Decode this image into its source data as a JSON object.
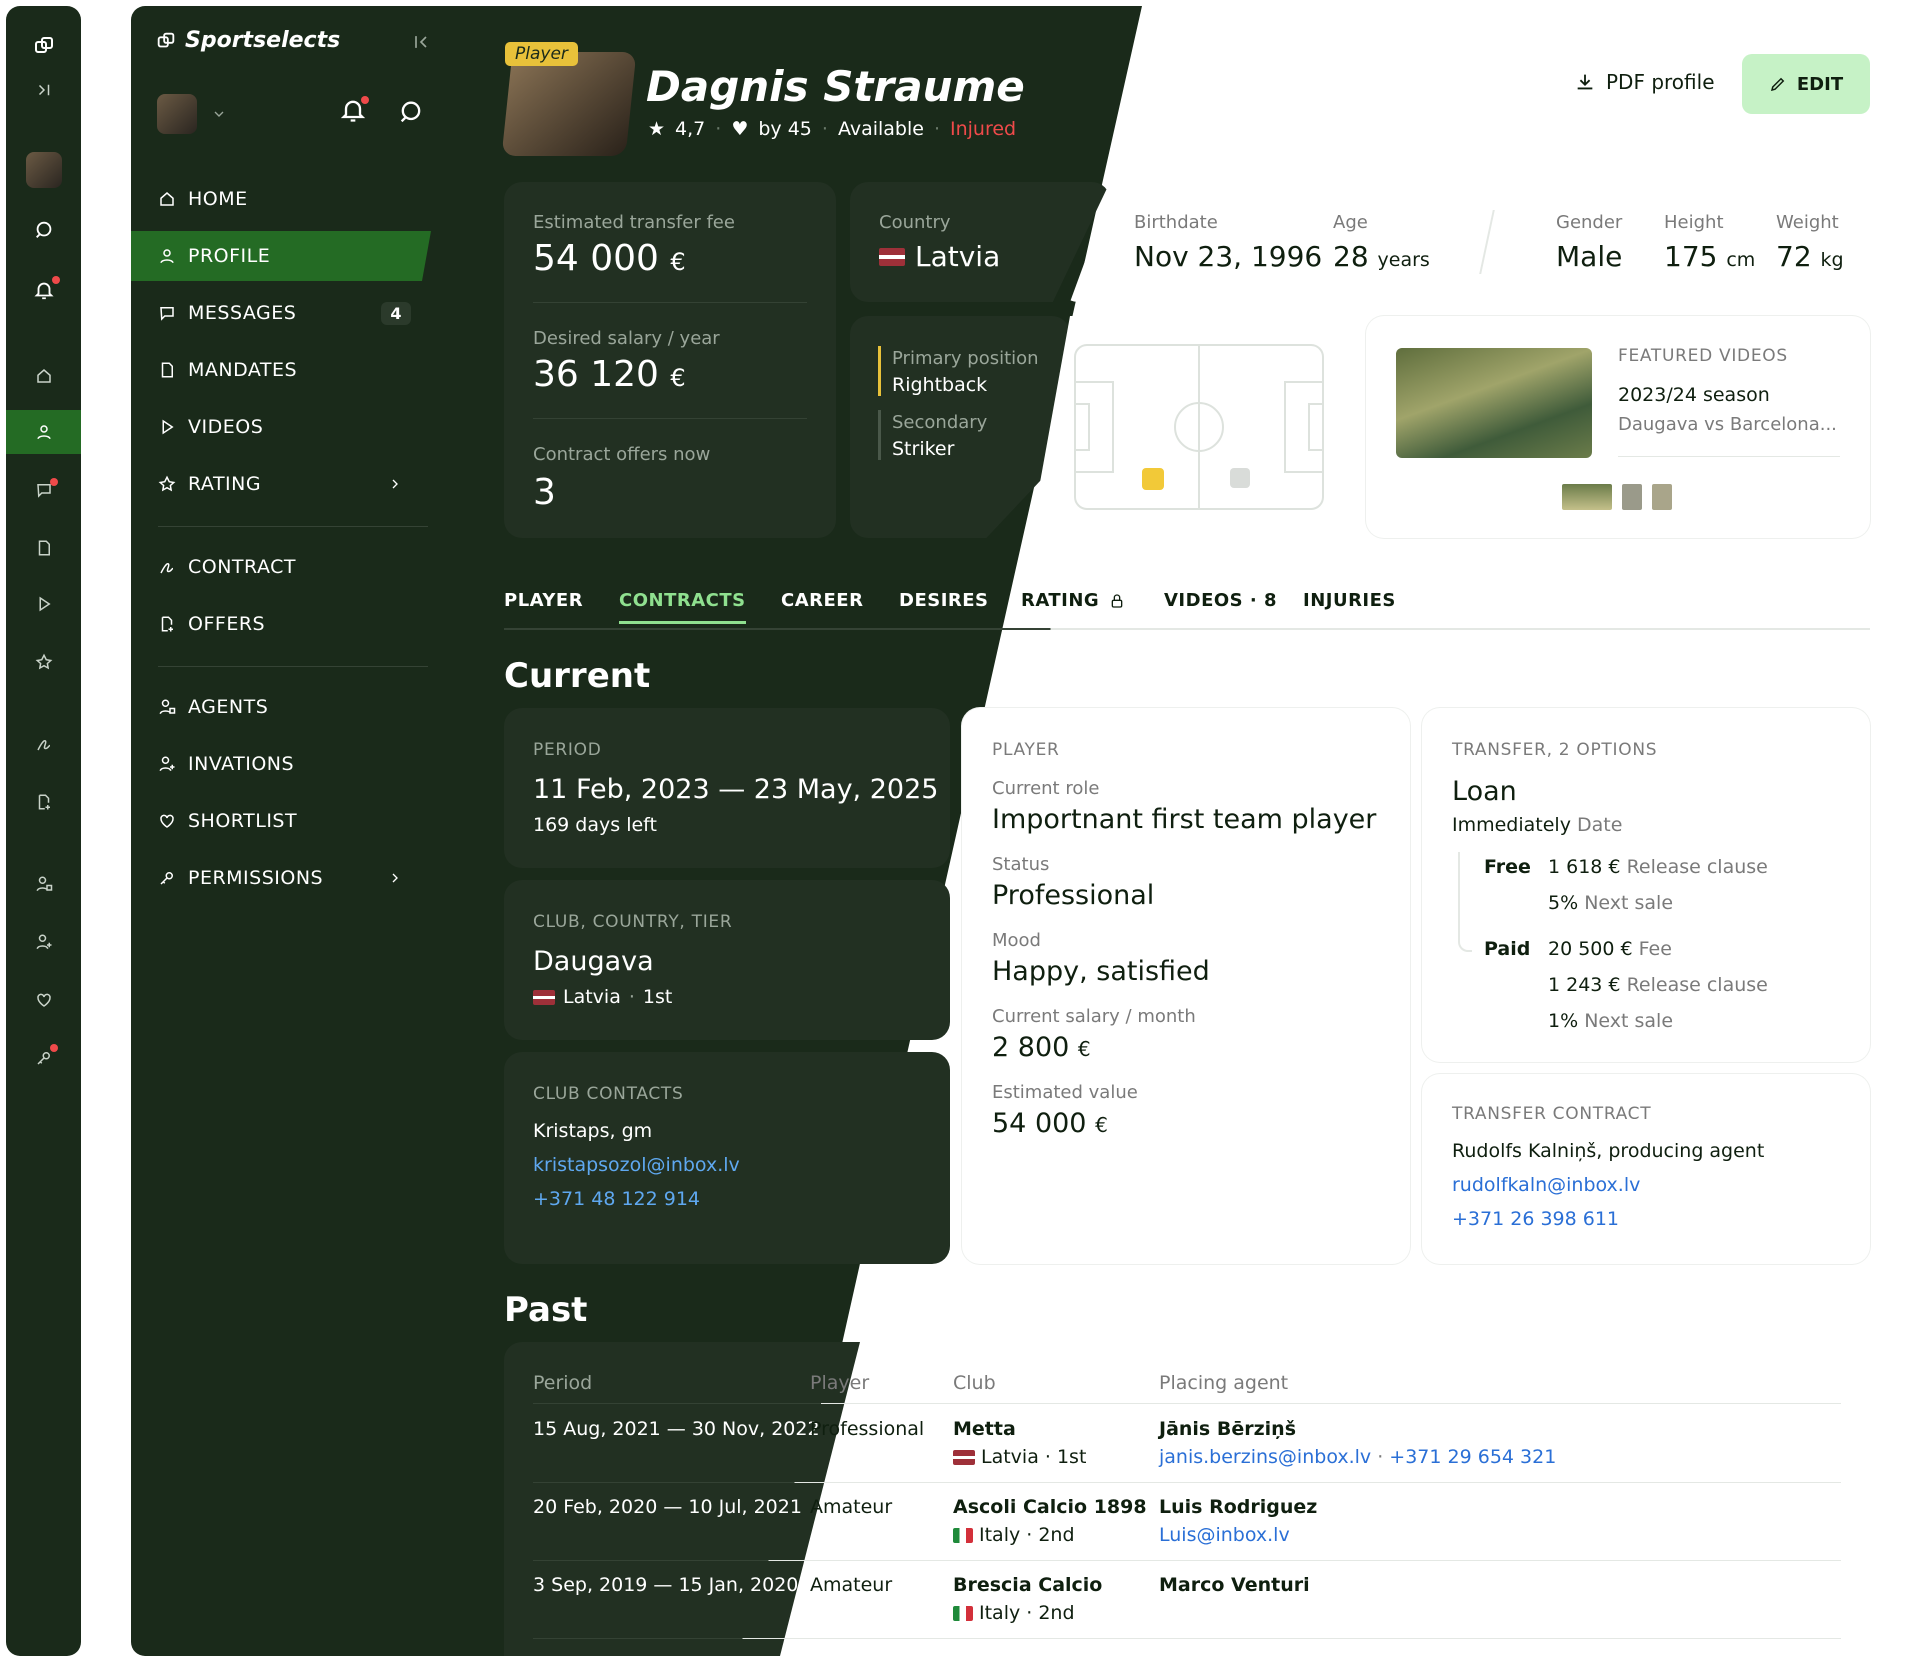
{
  "rail": {
    "icons": [
      "logo",
      "expand",
      "avatar",
      "search",
      "bell",
      "home",
      "profile",
      "messages",
      "mandates",
      "videos",
      "rating",
      "contract",
      "offers",
      "agents",
      "invations",
      "shortlist",
      "permissions"
    ]
  },
  "sidebar": {
    "brand": "Sportselects",
    "items": [
      {
        "label": "HOME"
      },
      {
        "label": "PROFILE"
      },
      {
        "label": "MESSAGES",
        "badge": "4"
      },
      {
        "label": "MANDATES"
      },
      {
        "label": "VIDEOS"
      },
      {
        "label": "RATING"
      },
      {
        "label": "CONTRACT"
      },
      {
        "label": "OFFERS"
      },
      {
        "label": "AGENTS"
      },
      {
        "label": "INVATIONS"
      },
      {
        "label": "SHORTLIST"
      },
      {
        "label": "PERMISSIONS"
      }
    ]
  },
  "header": {
    "tag": "Player",
    "name": "Dagnis Straume",
    "rating": "4,7",
    "likes": "by 45",
    "available": "Available",
    "injured": "Injured",
    "pdf": "PDF profile",
    "edit": "EDIT"
  },
  "stats": {
    "fee_label": "Estimated transfer fee",
    "fee": "54 000",
    "fee_cur": "€",
    "salary_label": "Desired salary / year",
    "salary": "36 120",
    "salary_cur": "€",
    "offers_label": "Contract offers now",
    "offers": "3",
    "country_label": "Country",
    "country": "Latvia",
    "birth_label": "Birthdate",
    "birth": "Nov 23, 1996",
    "age_label": "Age",
    "age": "28",
    "age_unit": "years",
    "gender_label": "Gender",
    "gender": "Male",
    "height_label": "Height",
    "height": "175",
    "height_unit": "cm",
    "weight_label": "Weight",
    "weight": "72",
    "weight_unit": "kg",
    "primary_label": "Primary position",
    "primary": "Rightback",
    "secondary_label": "Secondary",
    "secondary": "Striker"
  },
  "videos": {
    "label": "FEATURED VIDEOS",
    "season": "2023/24 season",
    "match": "Daugava vs Barcelona..."
  },
  "tabs": [
    "PLAYER",
    "CONTRACTS",
    "CAREER",
    "DESIRES",
    "RATING",
    "VIDEOS · 8",
    "INJURIES"
  ],
  "current": {
    "title": "Current",
    "period_label": "PERIOD",
    "period": "11 Feb, 2023 — 23 May, 2025",
    "days_left": "169 days left",
    "club_label": "CLUB, COUNTRY, TIER",
    "club": "Daugava",
    "club_country": "Latvia",
    "club_tier": "1st",
    "contacts_label": "CLUB CONTACTS",
    "contact_name": "Kristaps, gm",
    "contact_email": "kristapsozol@inbox.lv",
    "contact_phone": "+371 48 122 914",
    "player_label": "PLAYER",
    "role_label": "Current role",
    "role": "Importnant first team player",
    "status_label": "Status",
    "status": "Professional",
    "mood_label": "Mood",
    "mood": "Happy, satisfied",
    "csal_label": "Current salary / month",
    "csal": "2 800",
    "csal_cur": "€",
    "est_label": "Estimated value",
    "est": "54 000",
    "est_cur": "€",
    "transfer_label": "TRANSFER, 2 OPTIONS",
    "loan": "Loan",
    "immediately": "Immediately",
    "date": "Date",
    "free": "Free",
    "free_release": "1 618 €",
    "release_clause": "Release clause",
    "free_next": "5%",
    "next_sale": "Next sale",
    "paid": "Paid",
    "paid_fee": "20 500 €",
    "fee_word": "Fee",
    "paid_release": "1 243 €",
    "paid_next": "1%",
    "tc_label": "TRANSFER CONTRACT",
    "tc_name": "Rudolfs Kalniņš, producing agent",
    "tc_email": "rudolfkaln@inbox.lv",
    "tc_phone": "+371 26 398 611"
  },
  "past": {
    "title": "Past",
    "headers": [
      "Period",
      "Player",
      "Club",
      "Placing agent"
    ],
    "rows": [
      {
        "period": "15 Aug, 2021 — 30 Nov, 2022",
        "player": "Professional",
        "club": "Metta",
        "country": "Latvia · 1st",
        "agent": "Jānis Bērziņš",
        "email": "janis.berzins@inbox.lv",
        "sep": " · ",
        "phone": "+371 29 654 321"
      },
      {
        "period": "20 Feb, 2020 — 10 Jul, 2021",
        "player": "Amateur",
        "club": "Ascoli Calcio 1898",
        "country": "Italy · 2nd",
        "agent": "Luis Rodriguez",
        "email": "Luis@inbox.lv",
        "sep": "",
        "phone": ""
      },
      {
        "period": "3 Sep, 2019 — 15 Jan, 2020",
        "player": "Amateur",
        "club": "Brescia Calcio",
        "country": "Italy · 2nd",
        "agent": "Marco Venturi",
        "email": "",
        "sep": "",
        "phone": ""
      }
    ]
  },
  "colors": {
    "dark": "#1a2a1a",
    "accent": "#246b24",
    "mint": "#c6f2c6",
    "injured": "#ef4a4a",
    "link": "#2a6fd6"
  }
}
